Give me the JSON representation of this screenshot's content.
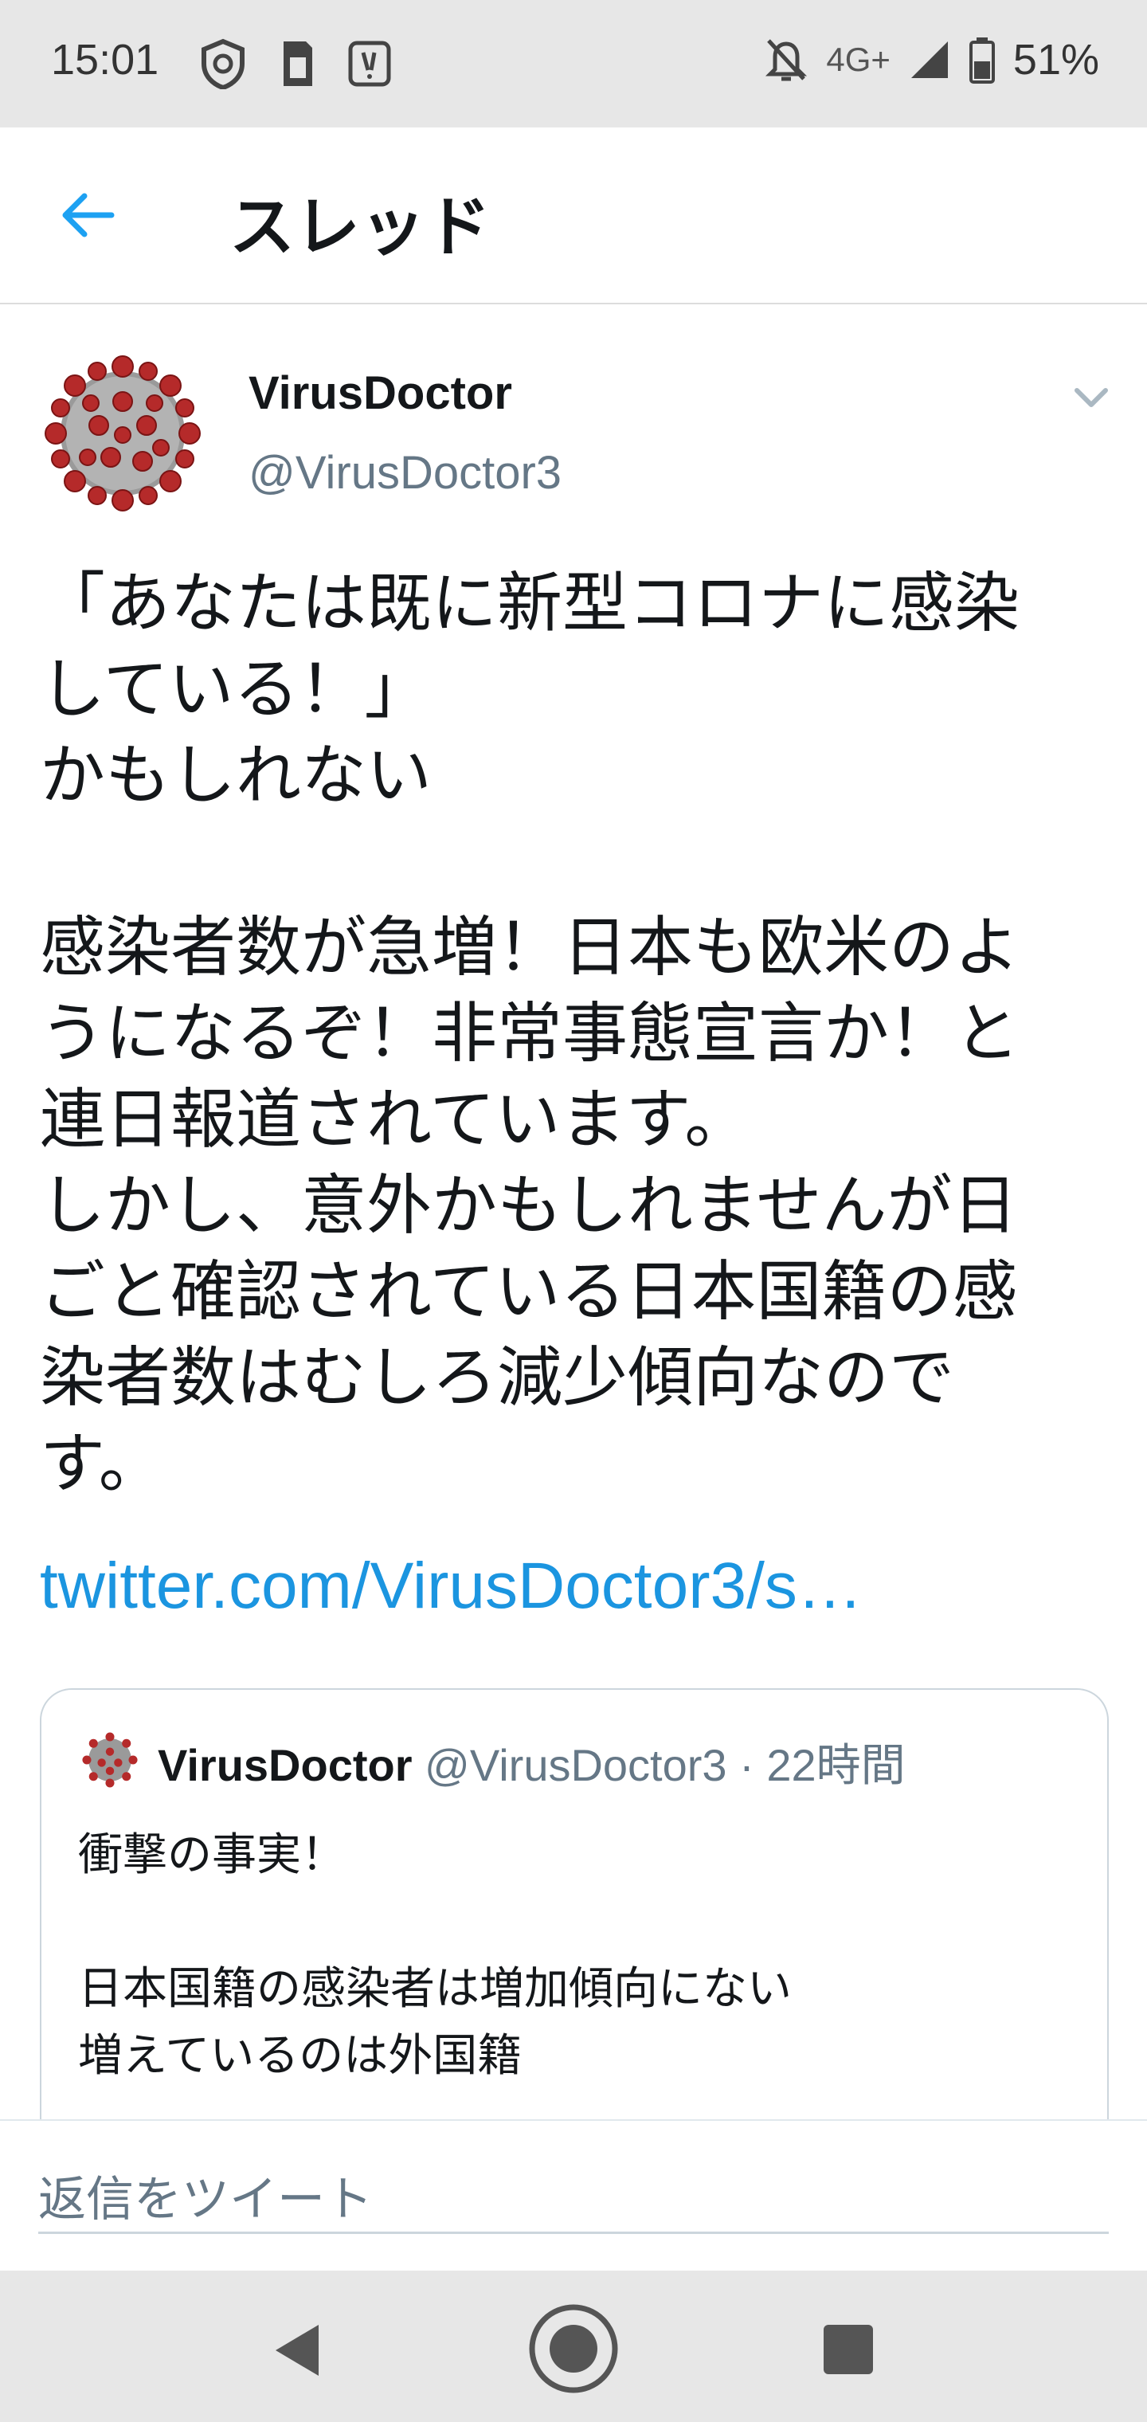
{
  "status_bar": {
    "time": "15:01",
    "network": "4G+",
    "battery": "51%"
  },
  "header": {
    "title": "スレッド",
    "accent_color": "#1da1f2"
  },
  "tweet": {
    "author_name": "VirusDoctor",
    "author_handle": "@VirusDoctor3",
    "body": "「あなたは既に新型コロナに感染\nしている！」\nかもしれない\n\n感染者数が急増！日本も欧米のよ\nうになるぞ！非常事態宣言か！と\n連日報道されています。\nしかし、意外かもしれませんが日\nごと確認されている日本国籍の感\n染者数はむしろ減少傾向なので\nす。",
    "link": "twitter.com/VirusDoctor3/s…",
    "quote": {
      "author_name": "VirusDoctor",
      "author_handle": "@VirusDoctor3",
      "separator": " · ",
      "time": "22時間",
      "text": "衝撃の事実！\n\n日本国籍の感染者は増加傾向にない\n増えているのは外国籍\n…"
    }
  },
  "reply": {
    "placeholder": "返信をツイート"
  },
  "icons": {
    "back": "arrow-left-icon",
    "caret": "chevron-down-icon",
    "nav_back": "triangle-back-icon",
    "nav_home": "circle-home-icon",
    "nav_recents": "square-recents-icon"
  }
}
